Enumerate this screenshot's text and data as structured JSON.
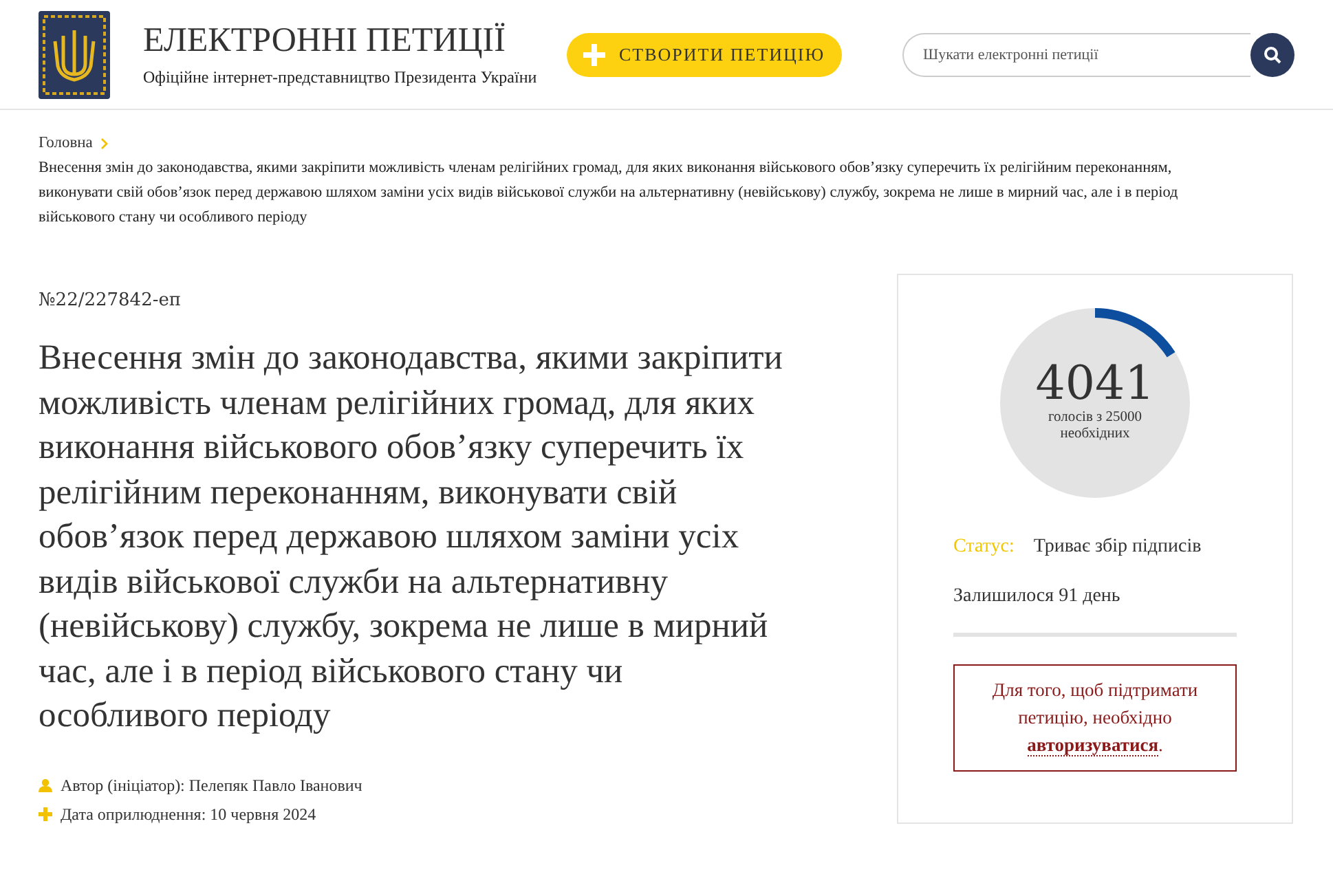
{
  "header": {
    "title": "ЕЛЕКТРОННІ ПЕТИЦІЇ",
    "subtitle": "Офіційне інтернет-представництво Президента України",
    "create_button": "СТВОРИТИ ПЕТИЦІЮ",
    "search": {
      "placeholder": "Шукати електронні петиції"
    }
  },
  "breadcrumb": [
    {
      "label": "Головна",
      "kind": "link"
    },
    {
      "label": "Внесення змін до законодавства, якими закріпити можливість членам релігійних громад, для яких виконання військового обов’язку суперечить їх релігійним переконанням, виконувати свій обов’язок перед державою шляхом заміни усіх видів військової служби на альтернативну (невійськову) службу, зокрема не лише в мирний час, але і в період військового стану чи особливого періоду",
      "kind": "current"
    }
  ],
  "petition": {
    "number": "№22/227842-еп",
    "title": "Внесення змін до законодавства, якими закріпити можливість членам релігійних громад, для яких виконання військового обов’язку суперечить їх релігійним переконанням, виконувати свій обов’язок перед державою шляхом заміни усіх видів військової служби на альтернативну (невійськову) службу, зокрема не лише в мирний час, але і в період військового стану чи особливого періоду",
    "meta": [
      {
        "kind": "author",
        "text": "Автор (ініціатор): Пелепяк Павло Іванович"
      },
      {
        "kind": "date",
        "text": "Дата оприлюднення: 10 червня 2024"
      }
    ]
  },
  "votes": {
    "count": "4041",
    "caption": "голосів з 25000 необхідних",
    "status_label": "Статус:",
    "status": "Триває збір підписів",
    "remaining": "Залишилося 91 день",
    "notice": "Для того, щоб підтримати петицію, необхідно **авторизуватися**."
  }
}
